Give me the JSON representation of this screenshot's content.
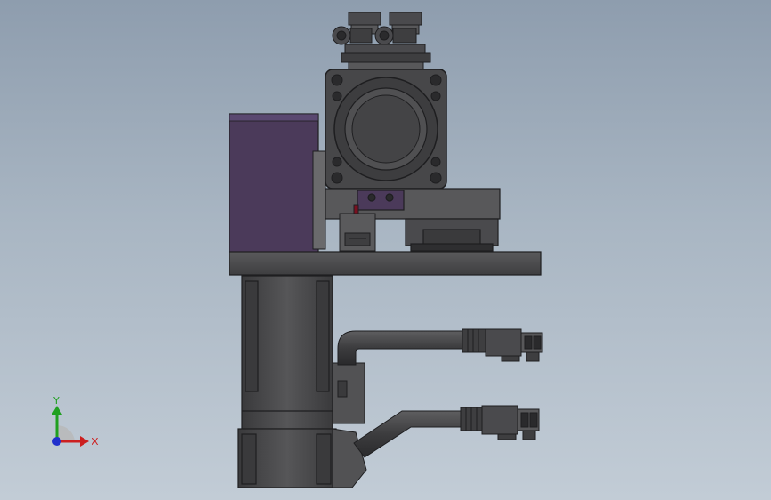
{
  "viewport": {
    "background_top": "#8e9dae",
    "background_bottom": "#c2ccd6"
  },
  "model": {
    "body_color": "#4a4a4d",
    "edge_color": "#1e1e20",
    "panel_color": "#4b3a5a",
    "marker_color": "#7a1020"
  },
  "triad": {
    "x_label": "X",
    "y_label": "Y",
    "x_color": "#cc2020",
    "y_color": "#20a020",
    "z_color": "#2030cc"
  }
}
